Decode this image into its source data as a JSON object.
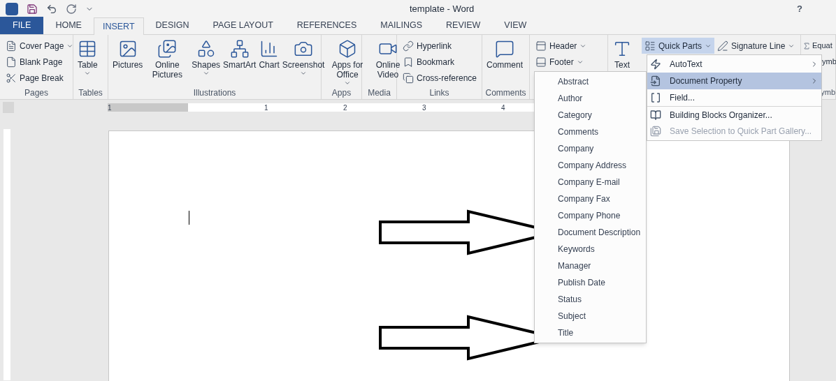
{
  "window": {
    "title": "template - Word",
    "help": "?"
  },
  "tabs": [
    {
      "label": "FILE",
      "selected": false,
      "kind": "file"
    },
    {
      "label": "HOME",
      "selected": false,
      "kind": "tab"
    },
    {
      "label": "INSERT",
      "selected": true,
      "kind": "tab"
    },
    {
      "label": "DESIGN",
      "selected": false,
      "kind": "tab"
    },
    {
      "label": "PAGE LAYOUT",
      "selected": false,
      "kind": "tab"
    },
    {
      "label": "REFERENCES",
      "selected": false,
      "kind": "tab"
    },
    {
      "label": "MAILINGS",
      "selected": false,
      "kind": "tab"
    },
    {
      "label": "REVIEW",
      "selected": false,
      "kind": "tab"
    },
    {
      "label": "VIEW",
      "selected": false,
      "kind": "tab"
    }
  ],
  "ribbon": [
    {
      "label": "Pages",
      "items": [
        {
          "label": "Cover Page",
          "kind": "small",
          "dropdown": true
        },
        {
          "label": "Blank Page",
          "kind": "small"
        },
        {
          "label": "Page Break",
          "kind": "small"
        }
      ]
    },
    {
      "label": "Tables",
      "items": [
        {
          "label": "Table",
          "kind": "large",
          "dropdown": true
        }
      ]
    },
    {
      "label": "Illustrations",
      "items": [
        {
          "label": "Pictures",
          "kind": "large"
        },
        {
          "label": "Online Pictures",
          "kind": "large"
        },
        {
          "label": "Shapes",
          "kind": "large",
          "dropdown": true
        },
        {
          "label": "SmartArt",
          "kind": "large"
        },
        {
          "label": "Chart",
          "kind": "large"
        },
        {
          "label": "Screenshot",
          "kind": "large",
          "dropdown": true
        }
      ]
    },
    {
      "label": "Apps",
      "items": [
        {
          "label": "Apps for Office",
          "kind": "large",
          "dropdown": true
        }
      ]
    },
    {
      "label": "Media",
      "items": [
        {
          "label": "Online Video",
          "kind": "large"
        }
      ]
    },
    {
      "label": "Links",
      "items": [
        {
          "label": "Hyperlink",
          "kind": "small"
        },
        {
          "label": "Bookmark",
          "kind": "small"
        },
        {
          "label": "Cross-reference",
          "kind": "small"
        }
      ]
    },
    {
      "label": "Comments",
      "items": [
        {
          "label": "Comment",
          "kind": "large"
        }
      ]
    },
    {
      "items": [
        {
          "label": "Header",
          "kind": "small",
          "dropdown": true
        },
        {
          "label": "Footer",
          "kind": "small",
          "dropdown": true
        }
      ]
    },
    {
      "items": [
        {
          "label": "Text",
          "kind": "large"
        },
        {
          "label": "Quick Parts",
          "kind": "small",
          "dropdown": true,
          "active": true
        },
        {
          "label": "Signature Line",
          "kind": "small",
          "dropdown": true,
          "active": false
        }
      ]
    },
    {
      "label": "ymb",
      "items": [
        {
          "label": "Equat",
          "kind": "small"
        },
        {
          "label": "ymb",
          "kind": "small"
        }
      ]
    }
  ],
  "ruler": {
    "numbers": [
      "1",
      "1",
      "2",
      "3",
      "4"
    ]
  },
  "quick_parts_menu": [
    {
      "label": "AutoText",
      "submenu": true,
      "selected": false,
      "disabled": false
    },
    {
      "label": "Document Property",
      "submenu": true,
      "selected": true,
      "disabled": false
    },
    {
      "label": "Field...",
      "submenu": false,
      "selected": false,
      "disabled": false
    },
    {
      "label": "Building Blocks Organizer...",
      "submenu": false,
      "selected": false,
      "disabled": false
    },
    {
      "label": "Save Selection to Quick Part Gallery...",
      "submenu": false,
      "selected": false,
      "disabled": true
    }
  ],
  "property_menu": [
    "Abstract",
    "Author",
    "Category",
    "Comments",
    "Company",
    "Company Address",
    "Company E-mail",
    "Company Fax",
    "Company Phone",
    "Document Description",
    "Keywords",
    "Manager",
    "Publish Date",
    "Status",
    "Subject",
    "Title"
  ]
}
